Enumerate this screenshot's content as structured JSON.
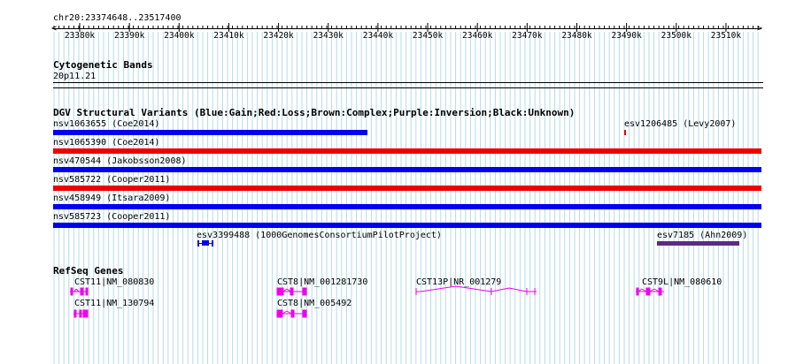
{
  "region": {
    "label": "chr20:23374648..23517400",
    "ticks": [
      "23380k",
      "23390k",
      "23400k",
      "23410k",
      "23420k",
      "23430k",
      "23440k",
      "23450k",
      "23460k",
      "23470k",
      "23480k",
      "23490k",
      "23500k",
      "23510k"
    ]
  },
  "cytobands": {
    "title": "Cytogenetic Bands",
    "band": "20p11.21"
  },
  "dgv": {
    "title": "DGV Structural Variants (Blue:Gain;Red:Loss;Brown:Complex;Purple:Inversion;Black:Unknown)",
    "variants": [
      {
        "label": "nsv1063655 (Coe2014)",
        "color": "#0000ee"
      },
      {
        "label": "esv1206485 (Levy2007)",
        "color": "#ee0000"
      },
      {
        "label": "nsv1065390 (Coe2014)",
        "color": "#ee0000"
      },
      {
        "label": "nsv470544 (Jakobsson2008)",
        "color": "#0000ee"
      },
      {
        "label": "nsv585722 (Cooper2011)",
        "color": "#ee0000"
      },
      {
        "label": "nsv458949 (Itsara2009)",
        "color": "#0000ee"
      },
      {
        "label": "nsv585723 (Cooper2011)",
        "color": "#0000ee"
      },
      {
        "label": "esv3399488 (1000GenomesConsortiumPilotProject)",
        "color": "#0000ee"
      },
      {
        "label": "esv7185 (Ahn2009)",
        "color": "#5b2a86"
      }
    ]
  },
  "refseq": {
    "title": "RefSeq Genes",
    "color": "#ee00ee",
    "genes": [
      {
        "label": "CST11|NM_080830"
      },
      {
        "label": "CST11|NM_130794"
      },
      {
        "label": "CST8|NM_001281730"
      },
      {
        "label": "CST8|NM_005492"
      },
      {
        "label": "CST13P|NR_001279"
      },
      {
        "label": "CST9L|NM_080610"
      }
    ]
  }
}
